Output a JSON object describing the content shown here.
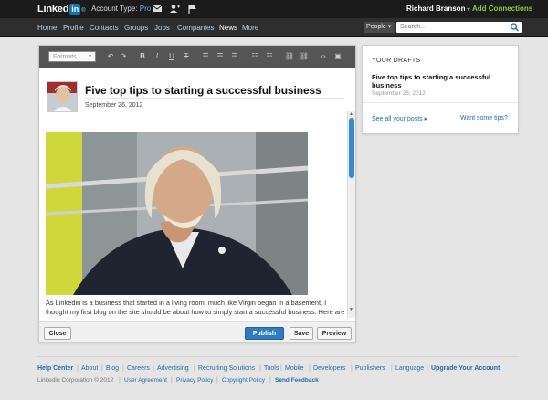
{
  "header": {
    "logo_text": "Linked",
    "logo_in": "in",
    "logo_mark": "®",
    "account_type_label": "Account Type:",
    "account_type_value": "Pro",
    "user_name": "Richard Branson",
    "user_caret": "▾",
    "add_connections": "Add Connections"
  },
  "nav": {
    "items": [
      "Home",
      "Profile",
      "Contacts",
      "Groups",
      "Jobs",
      "Companies",
      "News",
      "More"
    ],
    "active": "News",
    "people_select": "People ▾",
    "search_placeholder": "Search..."
  },
  "editor": {
    "formats_label": "Formats",
    "toolbar_glyphs": {
      "undo": "↶",
      "redo": "↷",
      "bold": "B",
      "italic": "I",
      "underline": "U",
      "strike": "T",
      "align_left": "☰",
      "align_center": "☰",
      "align_right": "☰",
      "bullets": "☷",
      "numbers": "☷",
      "link": "⛓",
      "unlink": "⛓",
      "code": "‹›",
      "image": "▣"
    },
    "post_title": "Five top tips to starting a successful business",
    "post_date": "September 26, 2012",
    "body_text": "As Linkedin is a business that started in a living room, much like Virgin began in a basement, I thought my first blog on the site should be about how to simply start a successful business. Here are five top tips the picked up over the years",
    "buttons": {
      "close": "Close",
      "publish": "Publish",
      "save": "Save",
      "preview": "Preview"
    }
  },
  "drafts": {
    "title": "YOUR DRAFTS",
    "draft_name": "Five top tips to starting a successful business",
    "draft_date": "September 26, 2012",
    "see_all": "See all your posts ▸",
    "want_tips": "Want some tips?"
  },
  "footer": {
    "links": [
      "Help Center",
      "About",
      "Blog",
      "Careers",
      "Advertising",
      "Recruiting Solutions",
      "Tools",
      "Mobile",
      "Developers",
      "Publishers",
      "Language",
      "Upgrade Your Account"
    ],
    "copyright": "LinkedIn Corporation © 2012",
    "legal_links": [
      "User Agreement",
      "Privacy Policy",
      "Copyright Policy",
      "Send Feedback"
    ]
  },
  "colors": {
    "accent": "#2f7bbd",
    "nav_link": "#b6d4ea",
    "add_connections": "#8cc73f",
    "header_bg": "#1b1b1b"
  }
}
